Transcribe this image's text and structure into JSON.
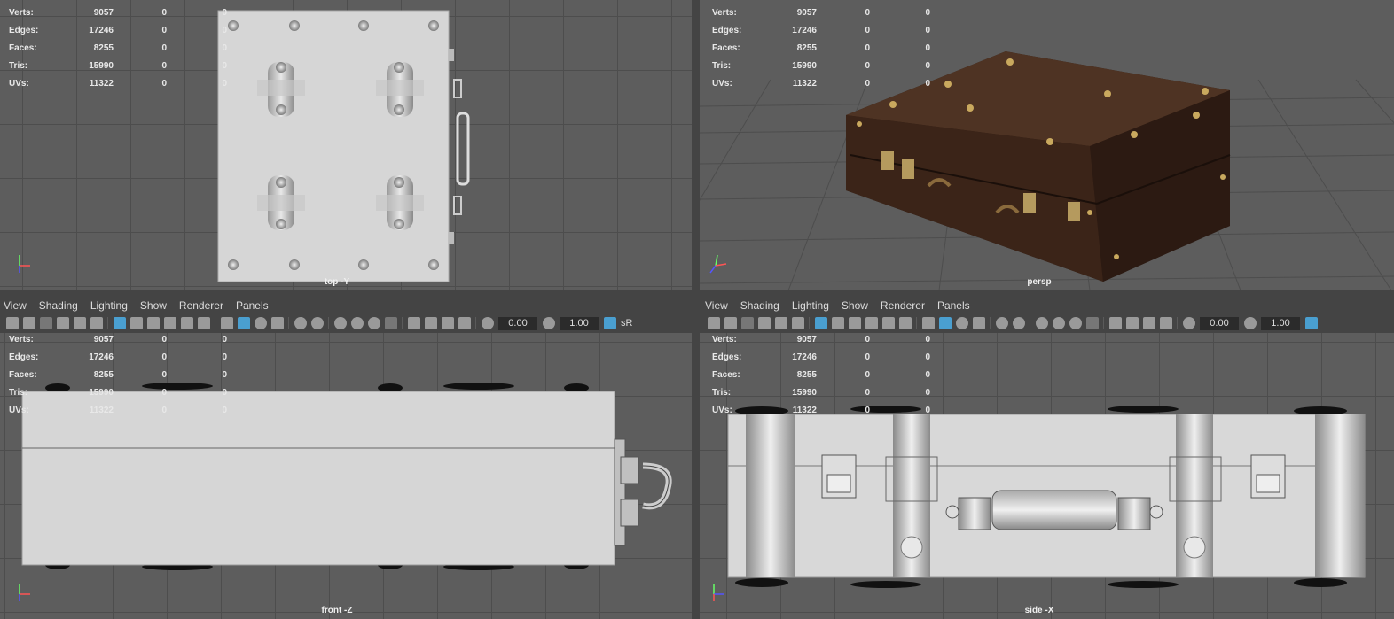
{
  "stats": {
    "labels": [
      "Verts:",
      "Edges:",
      "Faces:",
      "Tris:",
      "UVs:"
    ],
    "values": [
      "9057",
      "17246",
      "8255",
      "15990",
      "11322"
    ],
    "zeros": "0"
  },
  "viewports": {
    "top": {
      "camera": "top -Y"
    },
    "persp": {
      "camera": "persp"
    },
    "front": {
      "camera": "front -Z"
    },
    "side": {
      "camera": "side -X"
    }
  },
  "menus": {
    "items": [
      "View",
      "Shading",
      "Lighting",
      "Show",
      "Renderer",
      "Panels"
    ]
  },
  "toolbar": {
    "field1": "0.00",
    "field2": "1.00",
    "srgb": "sR"
  },
  "colors": {
    "viewport_bg": "#5d5d5d",
    "ui_bg": "#444444",
    "accent": "#4a9fd0",
    "suitcase_leather": "#4a2e20"
  },
  "icons": [
    "camera-icon",
    "grid-icon",
    "wireframe-icon",
    "shaded-icon",
    "texture-icon",
    "light-icon",
    "isolate-icon"
  ]
}
